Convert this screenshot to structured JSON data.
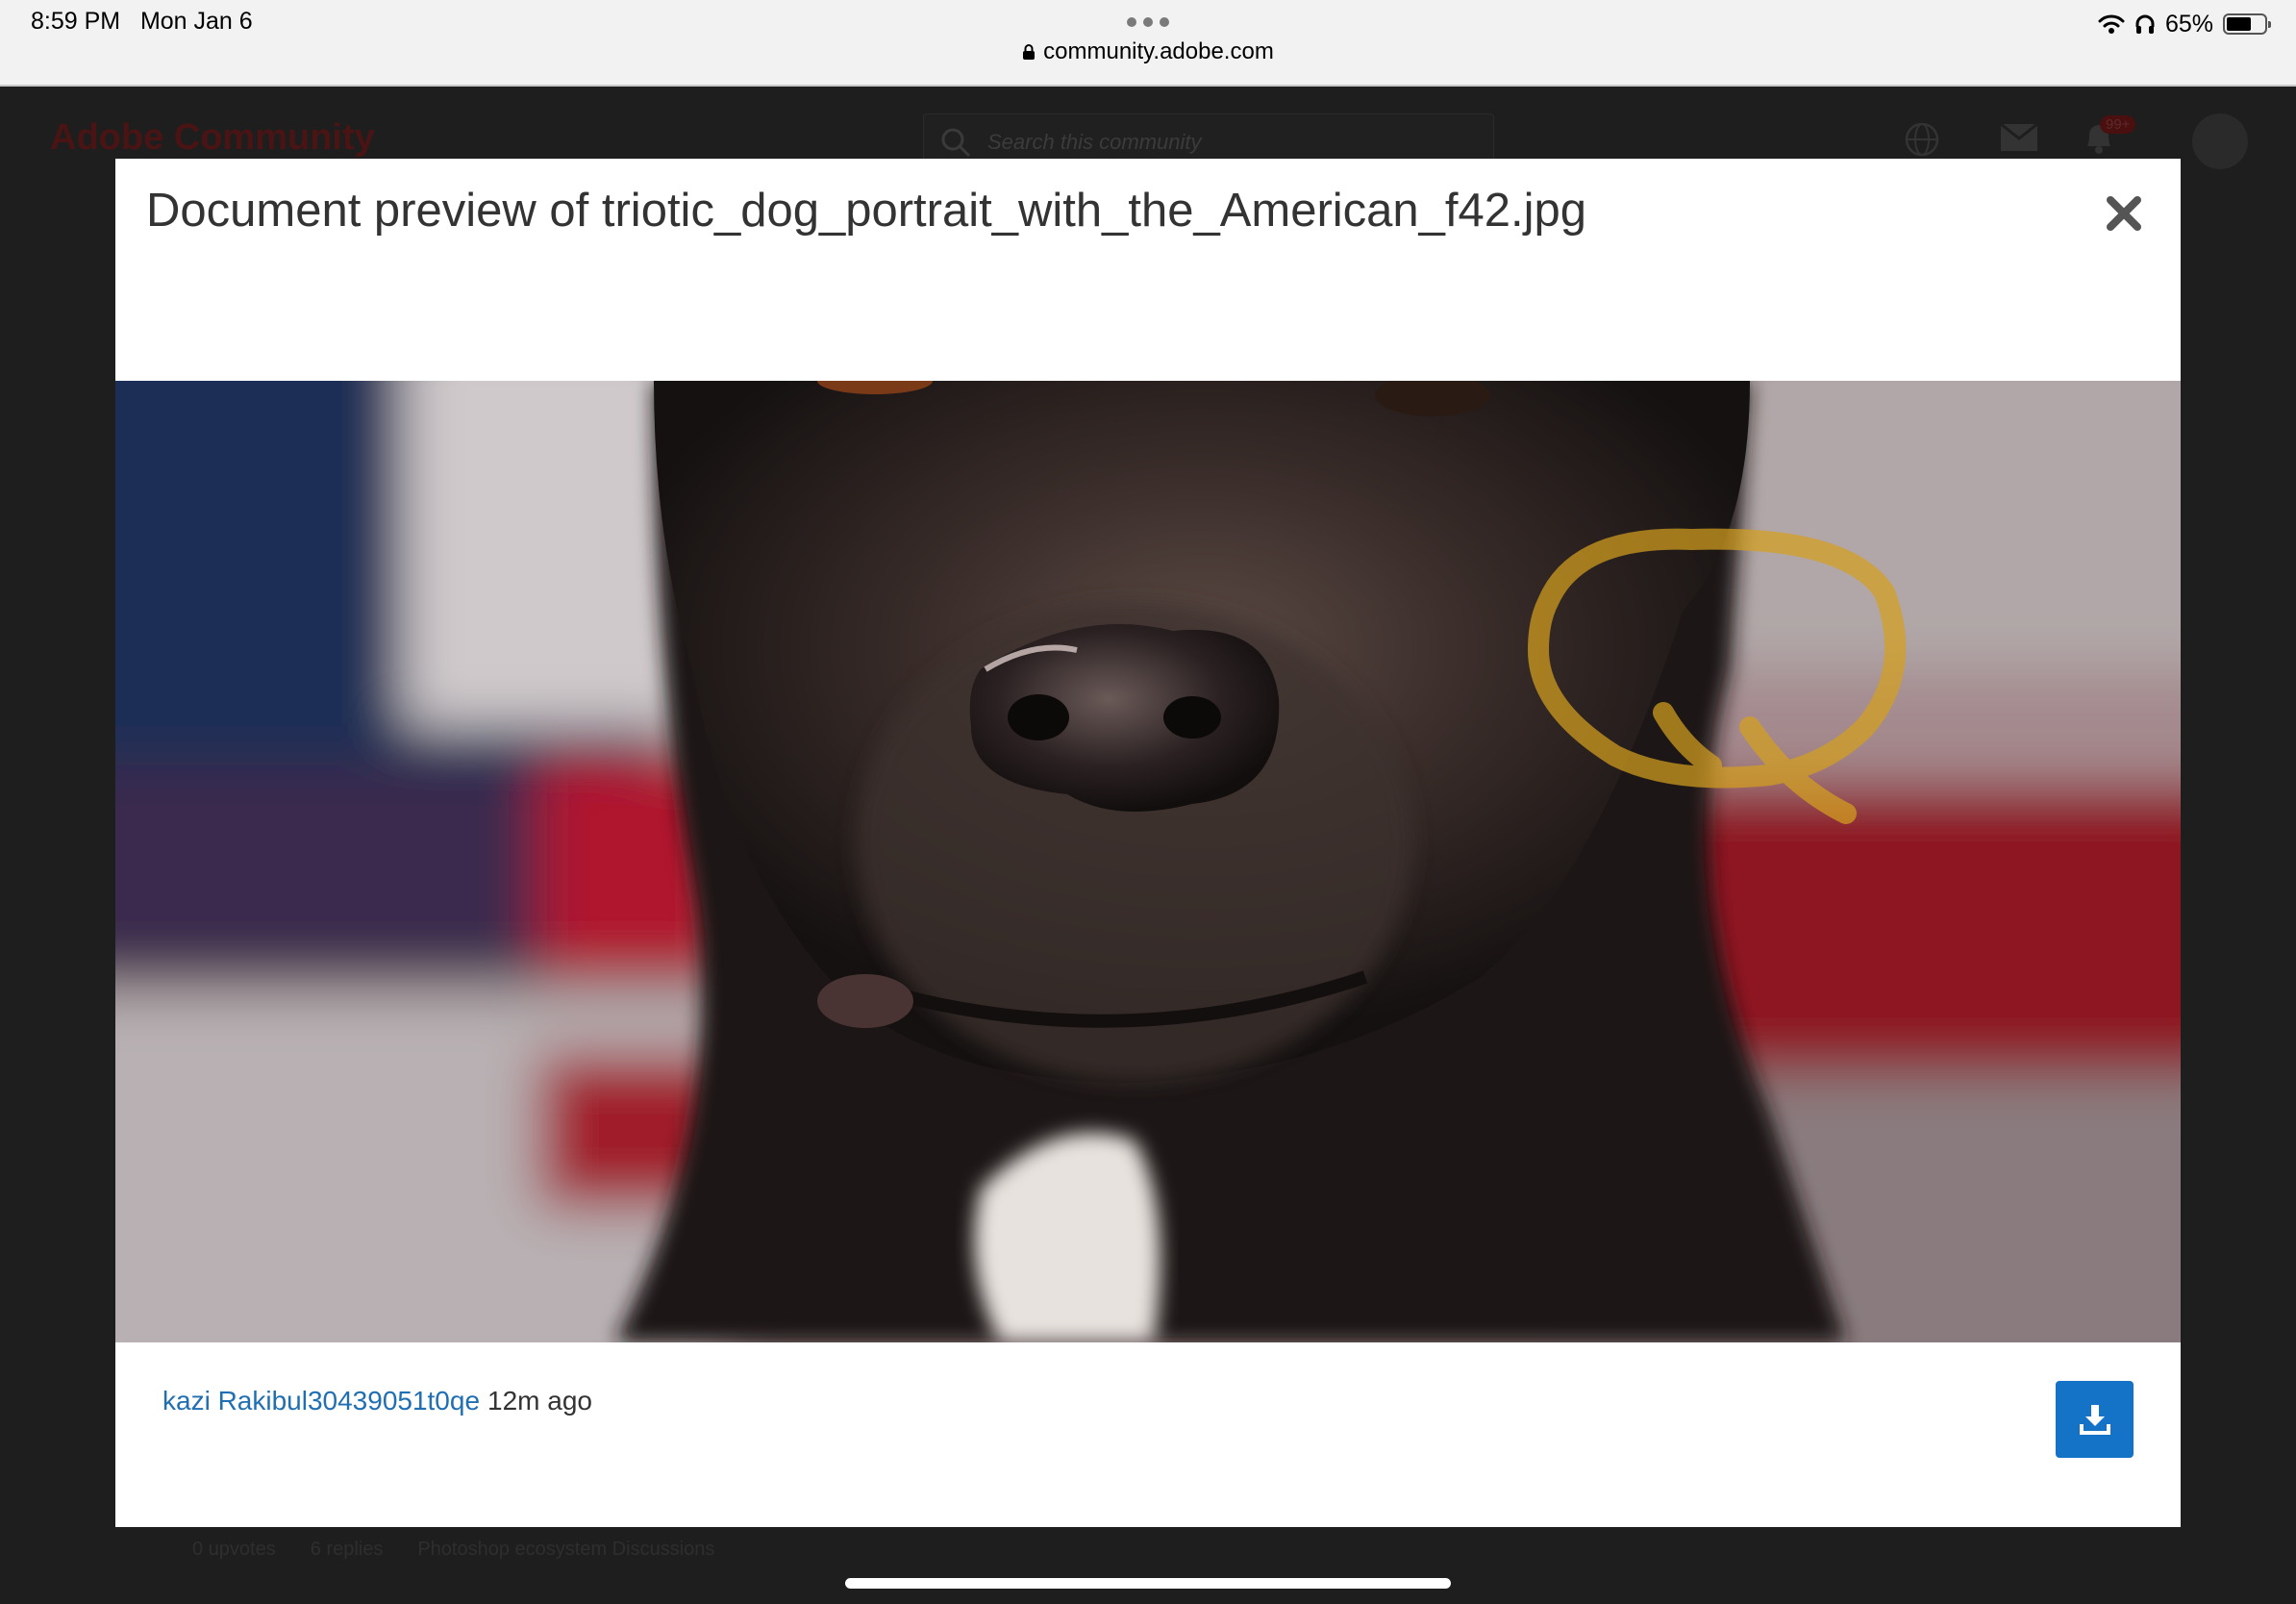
{
  "status_bar": {
    "time": "8:59 PM",
    "date": "Mon Jan 6",
    "url": "community.adobe.com",
    "battery_level": "65%",
    "battery_fraction": 0.65
  },
  "background_page": {
    "logo": "Adobe Community",
    "search_placeholder": "Search this community",
    "notification_badge": "99+",
    "footer": {
      "upvotes": "0 upvotes",
      "replies": "6 replies",
      "board": "Photoshop ecosystem Discussions"
    }
  },
  "modal": {
    "title": "Document preview of triotic_dog_portrait_with_the_American_f42.jpg",
    "image_alt": "triotic_dog_portrait_with_the_American_f42.jpg",
    "author": "kazi Rakibul30439051t0qe",
    "time_ago": "12m ago"
  },
  "colors": {
    "accent": "#1473c7",
    "link": "#1f6fb2",
    "annotation_stroke": "#d4a01e"
  }
}
